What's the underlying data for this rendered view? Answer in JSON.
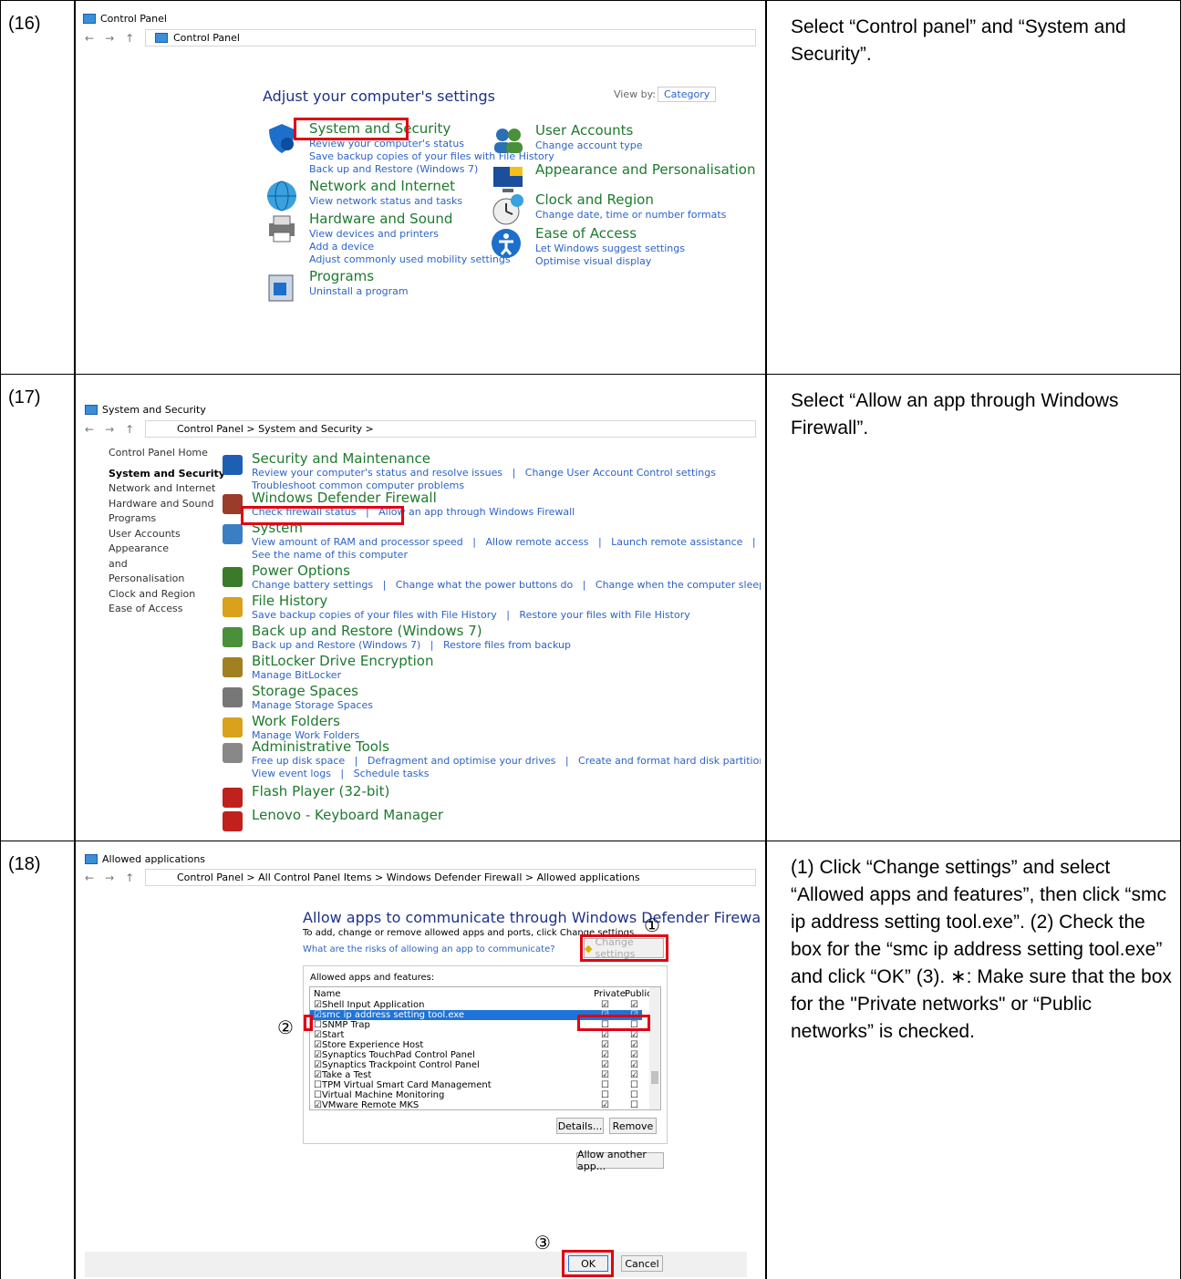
{
  "rows": [
    {
      "step": "(16)",
      "desc": "Select “Control panel” and “System and Security”."
    },
    {
      "step": "(17)",
      "desc": "Select “Allow an app through Windows Firewall”."
    },
    {
      "step": "(18)",
      "desc": "(1) Click “Change settings” and select “Allowed apps and features”, then click “smc ip address setting tool.exe”. (2) Check the box for the “smc ip address setting tool.exe” and click “OK” (3). ∗: Make sure that the box for the \"Private networks\" or “Public networks” is checked."
    }
  ],
  "cp": {
    "title": "Control Panel",
    "address": "Control Panel",
    "heading": "Adjust your computer's settings",
    "viewby": "View by:",
    "viewby_value": "Category",
    "categories": [
      {
        "title": "System and Security",
        "links": [
          "Review your computer's status",
          "Save backup copies of your files with File History",
          "Back up and Restore (Windows 7)"
        ]
      },
      {
        "title": "Network and Internet",
        "links": [
          "View network status and tasks"
        ]
      },
      {
        "title": "Hardware and Sound",
        "links": [
          "View devices and printers",
          "Add a device",
          "Adjust commonly used mobility settings"
        ]
      },
      {
        "title": "Programs",
        "links": [
          "Uninstall a program"
        ]
      },
      {
        "title": "User Accounts",
        "links": [
          "Change account type"
        ]
      },
      {
        "title": "Appearance and Personalisation",
        "links": []
      },
      {
        "title": "Clock and Region",
        "links": [
          "Change date, time or number formats"
        ]
      },
      {
        "title": "Ease of Access",
        "links": [
          "Let Windows suggest settings",
          "Optimise visual display"
        ]
      }
    ]
  },
  "ss": {
    "title": "System and Security",
    "address": "Control Panel  >  System and Security  >",
    "sidebar": [
      "Control Panel Home",
      "System and Security",
      "Network and Internet",
      "Hardware and Sound",
      "Programs",
      "User Accounts",
      "Appearance and Personalisation",
      "Clock and Region",
      "Ease of Access"
    ],
    "sections": [
      {
        "title": "Security and Maintenance",
        "l1": "Review your computer's status and resolve issues   |   Change User Account Control settings",
        "l2": "Troubleshoot common computer problems"
      },
      {
        "title": "Windows Defender Firewall",
        "l1": "Check firewall status   |   Allow an app through Windows Firewall",
        "l2": ""
      },
      {
        "title": "System",
        "l1": "View amount of RAM and processor speed   |   Allow remote access   |   Launch remote assistance   |",
        "l2": "See the name of this computer"
      },
      {
        "title": "Power Options",
        "l1": "Change battery settings   |   Change what the power buttons do   |   Change when the computer sleeps",
        "l2": ""
      },
      {
        "title": "File History",
        "l1": "Save backup copies of your files with File History   |   Restore your files with File History",
        "l2": ""
      },
      {
        "title": "Back up and Restore (Windows 7)",
        "l1": "Back up and Restore (Windows 7)   |   Restore files from backup",
        "l2": ""
      },
      {
        "title": "BitLocker Drive Encryption",
        "l1": "Manage BitLocker",
        "l2": ""
      },
      {
        "title": "Storage Spaces",
        "l1": "Manage Storage Spaces",
        "l2": ""
      },
      {
        "title": "Work Folders",
        "l1": "Manage Work Folders",
        "l2": ""
      },
      {
        "title": "Administrative Tools",
        "l1": "Free up disk space   |   Defragment and optimise your drives   |   Create and format hard disk partitions",
        "l2": "View event logs   |   Schedule tasks"
      },
      {
        "title": "Flash Player (32-bit)",
        "l1": "",
        "l2": ""
      },
      {
        "title": "Lenovo - Keyboard Manager",
        "l1": "",
        "l2": ""
      }
    ]
  },
  "fw": {
    "title": "Allowed applications",
    "address": "Control Panel  >  All Control Panel Items  >  Windows Defender Firewall  >  Allowed applications",
    "heading": "Allow apps to communicate through Windows Defender Firewall",
    "sub": "To add, change or remove allowed apps and ports, click Change settings.",
    "risk": "What are the risks of allowing an app to communicate?",
    "change": "Change settings",
    "list_label": "Allowed apps and features:",
    "col_name": "Name",
    "col_private": "Private",
    "col_public": "Public",
    "apps": [
      {
        "name": "☑Shell Input Application",
        "p": "☑",
        "q": "☑"
      },
      {
        "name": "☑smc ip address setting tool.exe",
        "p": "☑",
        "q": "☑"
      },
      {
        "name": "☐SNMP Trap",
        "p": "☐",
        "q": "☐"
      },
      {
        "name": "☑Start",
        "p": "☑",
        "q": "☑"
      },
      {
        "name": "☑Store Experience Host",
        "p": "☑",
        "q": "☑"
      },
      {
        "name": "☑Synaptics TouchPad Control Panel",
        "p": "☑",
        "q": "☑"
      },
      {
        "name": "☑Synaptics Trackpoint Control Panel",
        "p": "☑",
        "q": "☑"
      },
      {
        "name": "☑Take a Test",
        "p": "☑",
        "q": "☑"
      },
      {
        "name": "☐TPM Virtual Smart Card Management",
        "p": "☐",
        "q": "☐"
      },
      {
        "name": "☐Virtual Machine Monitoring",
        "p": "☐",
        "q": "☐"
      },
      {
        "name": "☑VMware Remote MKS",
        "p": "☑",
        "q": "☐"
      }
    ],
    "details": "Details...",
    "remove": "Remove",
    "allow_another": "Allow another app...",
    "ok": "OK",
    "cancel": "Cancel",
    "m1": "①",
    "m2": "②",
    "m3": "③"
  }
}
